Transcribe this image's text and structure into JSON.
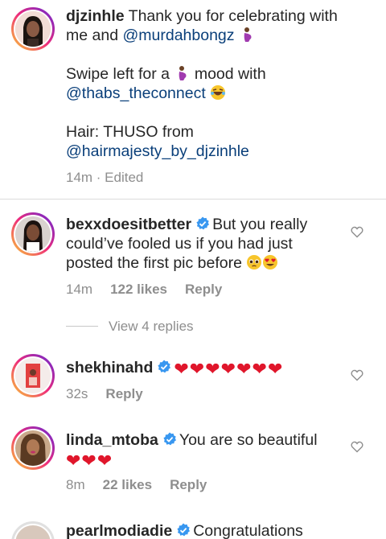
{
  "caption": {
    "username": "djzinhle",
    "text1": " Thank you for celebrating with me and ",
    "mention1": "@murdahbongz",
    "text2": "Swipe left for a ",
    "text3": " mood with",
    "mention2": "@thabs_theconnect",
    "text4": "Hair: THUSO from",
    "mention3": "@hairmajesty_by_djzinhle",
    "time": "14m",
    "edited": " · Edited"
  },
  "comments": [
    {
      "username": "bexxdoesitbetter",
      "text": "But you really could’ve fooled us if you had just posted the first pic before",
      "time": "14m",
      "likes": "122 likes",
      "reply": "Reply",
      "view_replies": "View 4 replies",
      "verified": true
    },
    {
      "username": "shekhinahd",
      "hearts": "❤❤❤❤❤❤❤",
      "time": "32s",
      "reply": "Reply",
      "verified": true
    },
    {
      "username": "linda_mtoba",
      "text": "You are so beautiful",
      "hearts": "❤❤❤",
      "time": "8m",
      "likes": "22 likes",
      "reply": "Reply",
      "verified": true
    },
    {
      "username": "pearlmodiadie",
      "text": "Congratulations",
      "verified": true
    }
  ],
  "colors": {
    "mention": "#0a3f7a",
    "verified": "#3897f0",
    "heart": "#e0162b",
    "meta": "#8e8e8e"
  },
  "icons": [
    "pregnant-emoji-icon",
    "laughing-emoji-icon",
    "pleading-emoji-icon",
    "heart-eyes-emoji-icon",
    "verified-badge-icon",
    "like-heart-icon"
  ]
}
